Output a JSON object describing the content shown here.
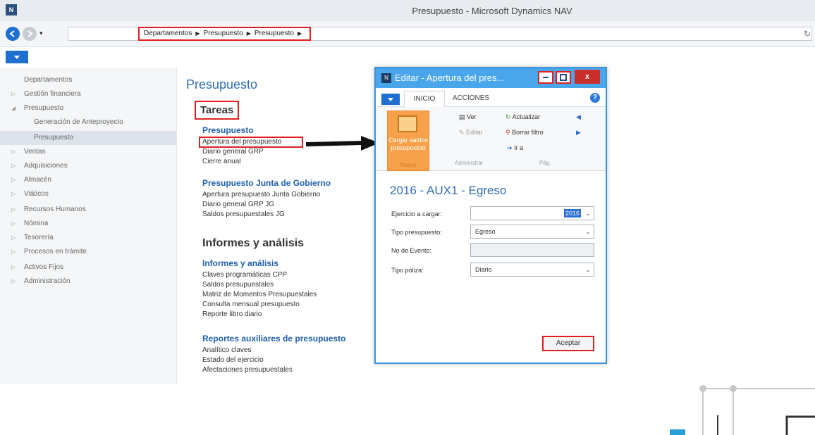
{
  "window": {
    "title": "Presupuesto - Microsoft Dynamics NAV"
  },
  "nav": {
    "breadcrumb": [
      "Departamentos",
      "Presupuesto",
      "Presupuesto"
    ]
  },
  "sidebar": {
    "items": [
      {
        "label": "Departamentos"
      },
      {
        "label": "Gestión financiera"
      },
      {
        "label": "Presupuesto"
      },
      {
        "label": "Generación de Anteproyecto"
      },
      {
        "label": "Presupuesto"
      },
      {
        "label": "Ventas"
      },
      {
        "label": "Adquisiciones"
      },
      {
        "label": "Almacén"
      },
      {
        "label": "Viáticos"
      },
      {
        "label": "Recursos Humanos"
      },
      {
        "label": "Nómina"
      },
      {
        "label": "Tesorería"
      },
      {
        "label": "Procesos en trámite"
      },
      {
        "label": "Activos Fijos"
      },
      {
        "label": "Administración"
      }
    ]
  },
  "main": {
    "title": "Presupuesto",
    "tareas": "Tareas",
    "groups": [
      {
        "heading": "Presupuesto",
        "links": [
          "Apertura del presupuesto",
          "Diario general GRP",
          "Cierre anual"
        ]
      },
      {
        "heading": "Presupuesto Junta de Gobierno",
        "links": [
          "Apertura presupuesto Junta Gobierno",
          "Diario general GRP JG",
          "Saldos presupuestales JG"
        ]
      }
    ],
    "informes_title": "Informes y análisis",
    "report_groups": [
      {
        "heading": "Informes y análisis",
        "links": [
          "Claves programáticas CPP",
          "Saldos presupuestales",
          "Matriz de Momentos Presupuestales",
          "Consulta mensual presupuesto",
          "Reporte libro diario"
        ]
      },
      {
        "heading": "Reportes auxiliares de presupuesto",
        "links": [
          "Analítico claves",
          "Estado del ejercicio",
          "Afectaciones presupuestales"
        ]
      }
    ]
  },
  "dialog": {
    "title": "Editar - Apertura del pres...",
    "close_label": "x",
    "tabs": [
      "INICIO",
      "ACCIONES"
    ],
    "ribbon": {
      "cargar": "Cargar saldos presupuesto",
      "group1": "Nuevo",
      "ver": "Ver",
      "editar": "Editar",
      "group2": "Administrar",
      "actualizar": "Actualizar",
      "borrar_filtro": "Borrar filtro",
      "ir_a": "Ir a",
      "group3": "Pág."
    },
    "heading": "2016 - AUX1 - Egreso",
    "fields": [
      {
        "label": "Ejercicio a cargar:",
        "value": "2016"
      },
      {
        "label": "Tipo presupuesto:",
        "value": "Egreso"
      },
      {
        "label": "No de Evento:",
        "value": ""
      },
      {
        "label": "Tipo póliza:",
        "value": "Diario"
      }
    ],
    "accept": "Aceptar"
  },
  "colors": {
    "accent": "#1f6fd1",
    "highlight": "#e02020",
    "dialog_border": "#3b93d8",
    "ribbon_action": "#f7a24a"
  }
}
